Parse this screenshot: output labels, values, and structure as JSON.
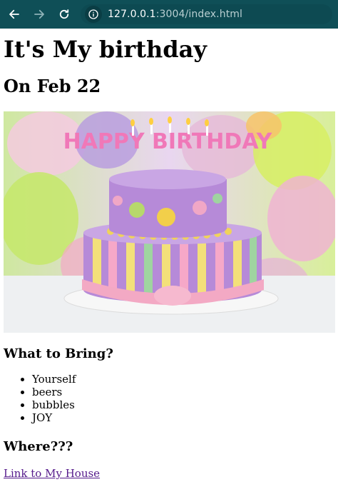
{
  "browser": {
    "url_host": "127.0.0.1",
    "url_rest": ":3004/index.html"
  },
  "page": {
    "title": "It's My birthday",
    "date_heading": "On Feb 22",
    "image_text": "HAPPY BIRTHDAY",
    "bring_heading": "What to Bring?",
    "bring_items": [
      "Yourself",
      "beers",
      "bubbles",
      "JOY"
    ],
    "where_heading": "Where???",
    "house_link": "Link to My House"
  }
}
